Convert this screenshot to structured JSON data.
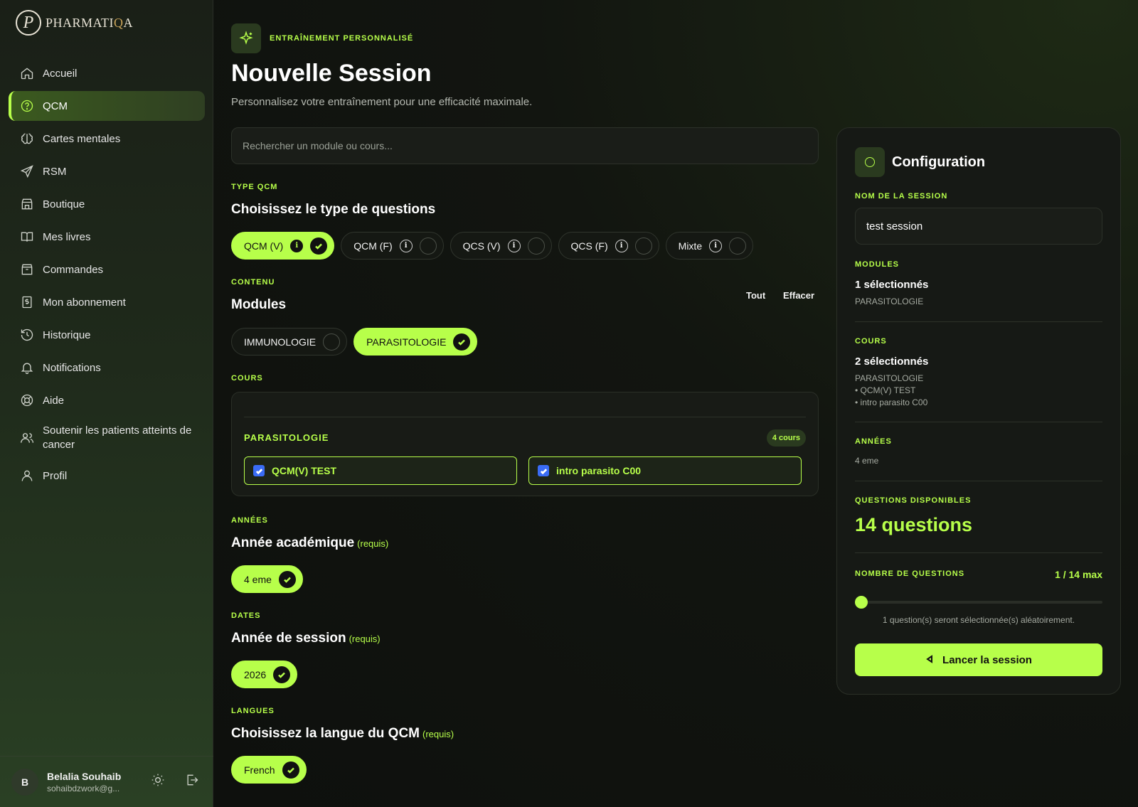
{
  "brand": {
    "mark": "P",
    "name_start": "PHARMATI",
    "name_q": "Q",
    "name_end": "A"
  },
  "sidebar": {
    "items": [
      {
        "label": "Accueil",
        "icon": "home-icon"
      },
      {
        "label": "QCM",
        "icon": "help-circle-icon",
        "active": true
      },
      {
        "label": "Cartes mentales",
        "icon": "brain-icon"
      },
      {
        "label": "RSM",
        "icon": "send-icon"
      },
      {
        "label": "Boutique",
        "icon": "store-icon"
      },
      {
        "label": "Mes livres",
        "icon": "book-icon"
      },
      {
        "label": "Commandes",
        "icon": "package-icon"
      },
      {
        "label": "Mon abonnement",
        "icon": "dollar-receipt-icon"
      },
      {
        "label": "Historique",
        "icon": "history-icon"
      },
      {
        "label": "Notifications",
        "icon": "bell-icon"
      },
      {
        "label": "Aide",
        "icon": "lifebuoy-icon"
      },
      {
        "label": "Soutenir les patients atteints de cancer",
        "icon": "users-icon"
      },
      {
        "label": "Profil",
        "icon": "user-icon"
      }
    ],
    "user": {
      "initial": "B",
      "name": "Belalia Souhaib",
      "email": "sohaibdzwork@g..."
    }
  },
  "header": {
    "eyebrow": "ENTRAÎNEMENT PERSONNALISÉ",
    "title": "Nouvelle Session",
    "subtitle": "Personnalisez votre entraînement pour une efficacité maximale."
  },
  "search": {
    "placeholder": "Rechercher un module ou cours..."
  },
  "qcm_type": {
    "label": "TYPE QCM",
    "title": "Choisissez le type de questions",
    "options": [
      {
        "label": "QCM (V)",
        "selected": true
      },
      {
        "label": "QCM (F)",
        "selected": false
      },
      {
        "label": "QCS (V)",
        "selected": false
      },
      {
        "label": "QCS (F)",
        "selected": false
      },
      {
        "label": "Mixte",
        "selected": false
      }
    ]
  },
  "content": {
    "label": "CONTENU",
    "title": "Modules",
    "all_label": "Tout",
    "clear_label": "Effacer",
    "modules": [
      {
        "label": "IMMUNOLOGIE",
        "selected": false
      },
      {
        "label": "PARASITOLOGIE",
        "selected": true
      }
    ]
  },
  "courses": {
    "label": "COURS",
    "module": "PARASITOLOGIE",
    "count": "4 cours",
    "items": [
      "QCM(V) TEST",
      "intro parasito C00"
    ]
  },
  "years": {
    "label": "ANNÉES",
    "title": "Année académique",
    "required": "(requis)",
    "options": [
      "4 eme"
    ]
  },
  "dates": {
    "label": "DATES",
    "title": "Année de session",
    "required": "(requis)",
    "options": [
      "2026"
    ]
  },
  "languages": {
    "label": "LANGUES",
    "title": "Choisissez la langue du QCM",
    "required": "(requis)",
    "options": [
      "French"
    ]
  },
  "config": {
    "title": "Configuration",
    "session_name_label": "NOM DE LA SESSION",
    "session_name_value": "test session",
    "modules_label": "MODULES",
    "modules_count": "1 sélectionnés",
    "modules_list": "PARASITOLOGIE",
    "courses_label": "COURS",
    "courses_count": "2 sélectionnés",
    "courses_module": "PARASITOLOGIE",
    "courses_items": [
      "• QCM(V) TEST",
      "• intro parasito C00"
    ],
    "years_label": "ANNÉES",
    "years_value": "4 eme",
    "available_label": "QUESTIONS DISPONIBLES",
    "available_value": "14 questions",
    "count_label": "NOMBRE DE QUESTIONS",
    "count_max": "1 / 14 max",
    "slider_value": 1,
    "slider_max": 14,
    "hint": "1 question(s) seront sélectionnée(s) aléatoirement.",
    "launch_label": "Lancer la session"
  },
  "colors": {
    "accent": "#b7ff4a",
    "background": "#0f110e",
    "checkbox": "#3a6cf5"
  }
}
